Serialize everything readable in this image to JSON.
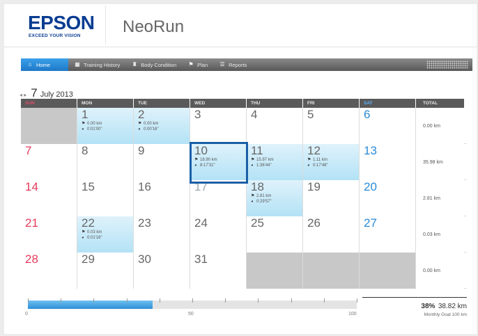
{
  "brand": {
    "logo_text": "EPSON",
    "tagline": "EXCEED YOUR VISION",
    "app_name": "NeoRun"
  },
  "nav": [
    {
      "label": "Home",
      "icon": "home-icon"
    },
    {
      "label": "Training History",
      "icon": "chart-icon"
    },
    {
      "label": "Body Condition",
      "icon": "body-icon"
    },
    {
      "label": "Plan",
      "icon": "flag-icon"
    },
    {
      "label": "Reports",
      "icon": "list-icon"
    }
  ],
  "month": {
    "arrows": "◂ ▸",
    "day": "7",
    "rest": "July 2013"
  },
  "weekdays": [
    "SUN",
    "MON",
    "TUE",
    "WED",
    "THU",
    "FRI",
    "SAT"
  ],
  "total_header": "TOTAL",
  "weeks": [
    {
      "days": [
        {
          "num": "",
          "style": "grey"
        },
        {
          "num": "1",
          "style": "blue",
          "distance": "0.00 km",
          "time": "0:01'00\""
        },
        {
          "num": "2",
          "style": "blue",
          "distance": "0.00 km",
          "time": "0:00'16\""
        },
        {
          "num": "3"
        },
        {
          "num": "4"
        },
        {
          "num": "5"
        },
        {
          "num": "6"
        }
      ],
      "total": "0.00 km"
    },
    {
      "days": [
        {
          "num": "7"
        },
        {
          "num": "8"
        },
        {
          "num": "9"
        },
        {
          "num": "10",
          "style": "blue",
          "distance": "18.90 km",
          "time": "8:17'31\""
        },
        {
          "num": "11",
          "style": "blue",
          "distance": "15.97 km",
          "time": "1:36'44\""
        },
        {
          "num": "12",
          "style": "blue",
          "distance": "1.11 km",
          "time": "0:17'48\""
        },
        {
          "num": "13"
        }
      ],
      "total": "35.98 km"
    },
    {
      "days": [
        {
          "num": "14"
        },
        {
          "num": "15"
        },
        {
          "num": "16"
        },
        {
          "num": "17"
        },
        {
          "num": "18",
          "style": "blue",
          "distance": "2.81 km",
          "time": "0:29'57\""
        },
        {
          "num": "19"
        },
        {
          "num": "20"
        }
      ],
      "total": "2.81 km"
    },
    {
      "days": [
        {
          "num": "21"
        },
        {
          "num": "22",
          "style": "blue",
          "distance": "0.03 km",
          "time": "0:01'16\""
        },
        {
          "num": "23"
        },
        {
          "num": "24"
        },
        {
          "num": "25"
        },
        {
          "num": "26"
        },
        {
          "num": "27"
        }
      ],
      "total": "0.03 km"
    },
    {
      "days": [
        {
          "num": "28"
        },
        {
          "num": "29"
        },
        {
          "num": "30"
        },
        {
          "num": "31"
        },
        {
          "num": "",
          "style": "grey"
        },
        {
          "num": "",
          "style": "grey"
        },
        {
          "num": "",
          "style": "grey"
        }
      ],
      "total": "0.00 km"
    }
  ],
  "progress": {
    "percent": 38,
    "percent_label": "38%",
    "km_label": "38.82 km",
    "goal_label": "Monthly Goal 100 km",
    "scale_min": "0",
    "scale_mid": "50",
    "scale_max": "100"
  },
  "colors": {
    "accent": "#1e78c8",
    "sunday": "#e53a5c",
    "saturday": "#2a8ad6",
    "logo": "#0a3d91"
  }
}
